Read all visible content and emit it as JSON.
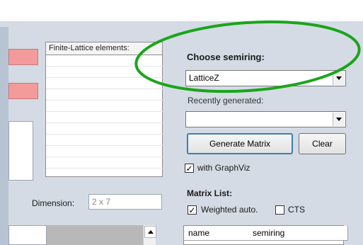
{
  "list": {
    "header": "Finite-Lattice elements:"
  },
  "dimension": {
    "label": "Dimension:",
    "value": "2 x 7"
  },
  "semiring": {
    "heading": "Choose semiring:",
    "selected": "LatticeZ"
  },
  "recent": {
    "label": "Recently generated:",
    "selected": ""
  },
  "buttons": {
    "generate": "Generate Matrix",
    "clear": "Clear"
  },
  "graphviz": {
    "label": "with GraphViz",
    "checked": true
  },
  "matrix_list": {
    "heading": "Matrix List:",
    "weighted_label": "Weighted auto.",
    "weighted_checked": true,
    "cts_label": "CTS",
    "cts_checked": false,
    "columns": [
      "name",
      "semiring"
    ]
  },
  "colors": {
    "annotation": "#1aa51a",
    "error_field": "#f39a9a",
    "focus": "#3c7fb1"
  },
  "icons": [
    "dropdown-arrow-icon",
    "scroll-up-arrow-icon",
    "checkmark-icon"
  ]
}
